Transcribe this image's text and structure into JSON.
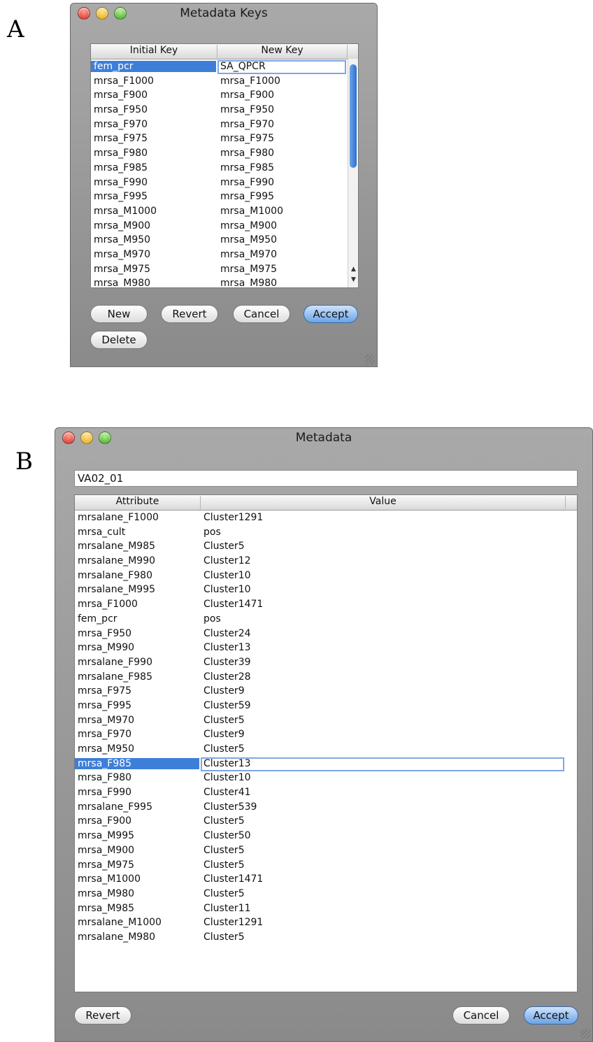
{
  "panel_a": {
    "letter": "A",
    "title": "Metadata Keys",
    "columns": [
      "Initial Key",
      "New Key"
    ],
    "rows": [
      [
        "fem_pcr",
        "SA_QPCR"
      ],
      [
        "mrsa_F1000",
        "mrsa_F1000"
      ],
      [
        "mrsa_F900",
        "mrsa_F900"
      ],
      [
        "mrsa_F950",
        "mrsa_F950"
      ],
      [
        "mrsa_F970",
        "mrsa_F970"
      ],
      [
        "mrsa_F975",
        "mrsa_F975"
      ],
      [
        "mrsa_F980",
        "mrsa_F980"
      ],
      [
        "mrsa_F985",
        "mrsa_F985"
      ],
      [
        "mrsa_F990",
        "mrsa_F990"
      ],
      [
        "mrsa_F995",
        "mrsa_F995"
      ],
      [
        "mrsa_M1000",
        "mrsa_M1000"
      ],
      [
        "mrsa_M900",
        "mrsa_M900"
      ],
      [
        "mrsa_M950",
        "mrsa_M950"
      ],
      [
        "mrsa_M970",
        "mrsa_M970"
      ],
      [
        "mrsa_M975",
        "mrsa_M975"
      ],
      [
        "mrsa_M980",
        "mrsa_M980"
      ]
    ],
    "buttons": {
      "new": "New",
      "revert": "Revert",
      "cancel": "Cancel",
      "accept": "Accept",
      "delete": "Delete"
    }
  },
  "panel_b": {
    "letter": "B",
    "title": "Metadata",
    "field_value": "VA02_01",
    "columns": [
      "Attribute",
      "Value"
    ],
    "rows": [
      [
        "mrsalane_F1000",
        "Cluster1291"
      ],
      [
        "mrsa_cult",
        "pos"
      ],
      [
        "mrsalane_M985",
        "Cluster5"
      ],
      [
        "mrsalane_M990",
        "Cluster12"
      ],
      [
        "mrsalane_F980",
        "Cluster10"
      ],
      [
        "mrsalane_M995",
        "Cluster10"
      ],
      [
        "mrsa_F1000",
        "Cluster1471"
      ],
      [
        "fem_pcr",
        "pos"
      ],
      [
        "mrsa_F950",
        "Cluster24"
      ],
      [
        "mrsa_M990",
        "Cluster13"
      ],
      [
        "mrsalane_F990",
        "Cluster39"
      ],
      [
        "mrsalane_F985",
        "Cluster28"
      ],
      [
        "mrsa_F975",
        "Cluster9"
      ],
      [
        "mrsa_F995",
        "Cluster59"
      ],
      [
        "mrsa_M970",
        "Cluster5"
      ],
      [
        "mrsa_F970",
        "Cluster9"
      ],
      [
        "mrsa_M950",
        "Cluster5"
      ],
      [
        "mrsa_F985",
        "Cluster13"
      ],
      [
        "mrsa_F980",
        "Cluster10"
      ],
      [
        "mrsa_F990",
        "Cluster41"
      ],
      [
        "mrsalane_F995",
        "Cluster539"
      ],
      [
        "mrsa_F900",
        "Cluster5"
      ],
      [
        "mrsa_M995",
        "Cluster50"
      ],
      [
        "mrsa_M900",
        "Cluster5"
      ],
      [
        "mrsa_M975",
        "Cluster5"
      ],
      [
        "mrsa_M1000",
        "Cluster1471"
      ],
      [
        "mrsa_M980",
        "Cluster5"
      ],
      [
        "mrsa_M985",
        "Cluster11"
      ],
      [
        "mrsalane_M1000",
        "Cluster1291"
      ],
      [
        "mrsalane_M980",
        "Cluster5"
      ]
    ],
    "buttons": {
      "revert": "Revert",
      "cancel": "Cancel",
      "accept": "Accept"
    }
  }
}
